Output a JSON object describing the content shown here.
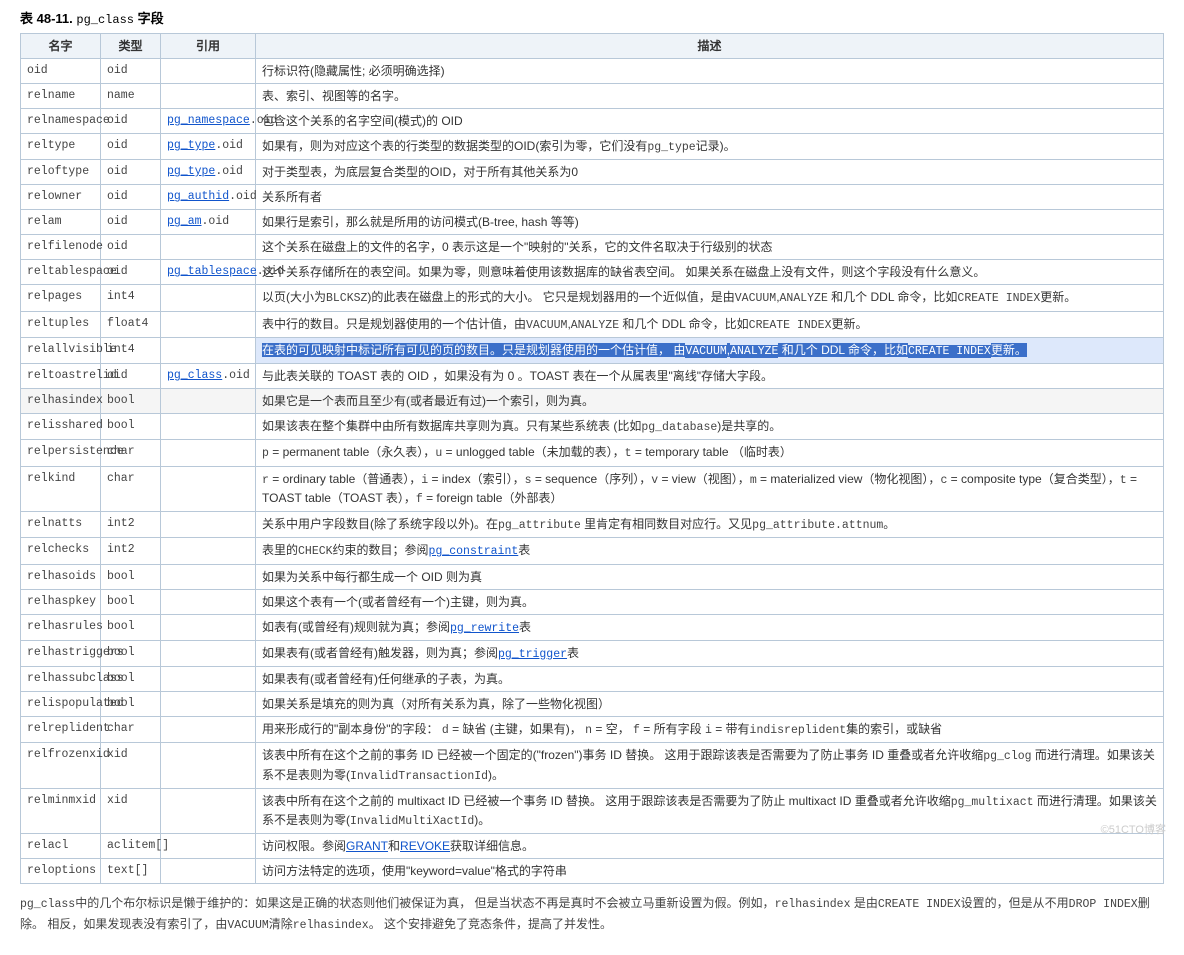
{
  "title_prefix": "表 48-11. ",
  "title_mono": "pg_class",
  "title_suffix": " 字段",
  "columns": {
    "name": "名字",
    "type": "类型",
    "ref": "引用",
    "desc": "描述"
  },
  "rows": [
    {
      "name": "oid",
      "type": "oid",
      "ref_link": "",
      "ref_suffix": "",
      "desc_parts": [
        {
          "t": "行标识符(隐藏属性; 必须明确选择)"
        }
      ]
    },
    {
      "name": "relname",
      "type": "name",
      "ref_link": "",
      "ref_suffix": "",
      "desc_parts": [
        {
          "t": "表、索引、视图等的名字。"
        }
      ]
    },
    {
      "name": "relnamespace",
      "type": "oid",
      "ref_link": "pg_namespace",
      "ref_suffix": ".oid",
      "desc_parts": [
        {
          "t": "包含这个关系的名字空间(模式)的 OID"
        }
      ]
    },
    {
      "name": "reltype",
      "type": "oid",
      "ref_link": "pg_type",
      "ref_suffix": ".oid",
      "desc_parts": [
        {
          "t": "如果有，则为对应这个表的行类型的数据类型的OID(索引为零，它们没有"
        },
        {
          "m": "pg_type"
        },
        {
          "t": "记录)。"
        }
      ]
    },
    {
      "name": "reloftype",
      "type": "oid",
      "ref_link": "pg_type",
      "ref_suffix": ".oid",
      "desc_parts": [
        {
          "t": "对于类型表，为底层复合类型的OID，对于所有其他关系为0"
        }
      ]
    },
    {
      "name": "relowner",
      "type": "oid",
      "ref_link": "pg_authid",
      "ref_suffix": ".oid",
      "desc_parts": [
        {
          "t": "关系所有者"
        }
      ]
    },
    {
      "name": "relam",
      "type": "oid",
      "ref_link": "pg_am",
      "ref_suffix": ".oid",
      "desc_parts": [
        {
          "t": "如果行是索引，那么就是所用的访问模式(B-tree, hash 等等)"
        }
      ]
    },
    {
      "name": "relfilenode",
      "type": "oid",
      "ref_link": "",
      "ref_suffix": "",
      "desc_parts": [
        {
          "t": "这个关系在磁盘上的文件的名字，0 表示这是一个\"映射的\"关系，它的文件名取决于行级别的状态"
        }
      ]
    },
    {
      "name": "reltablespace",
      "type": "oid",
      "ref_link": "pg_tablespace",
      "ref_suffix": ".oid",
      "desc_parts": [
        {
          "t": "这个关系存储所在的表空间。如果为零，则意味着使用该数据库的缺省表空间。 如果关系在磁盘上没有文件，则这个字段没有什么意义。"
        }
      ]
    },
    {
      "name": "relpages",
      "type": "int4",
      "ref_link": "",
      "ref_suffix": "",
      "desc_parts": [
        {
          "t": "以页(大小为"
        },
        {
          "m": "BLCKSZ"
        },
        {
          "t": ")的此表在磁盘上的形式的大小。 它只是规划器用的一个近似值，是由"
        },
        {
          "m": "VACUUM"
        },
        {
          "t": ","
        },
        {
          "m": "ANALYZE"
        },
        {
          "t": " 和几个 DDL 命令，比如"
        },
        {
          "m": "CREATE INDEX"
        },
        {
          "t": "更新。"
        }
      ]
    },
    {
      "name": "reltuples",
      "type": "float4",
      "ref_link": "",
      "ref_suffix": "",
      "desc_parts": [
        {
          "t": "表中行的数目。只是规划器使用的一个估计值，由"
        },
        {
          "m": "VACUUM"
        },
        {
          "t": ","
        },
        {
          "m": "ANALYZE"
        },
        {
          "t": " 和几个 DDL 命令，比如"
        },
        {
          "m": "CREATE INDEX"
        },
        {
          "t": "更新。"
        }
      ]
    },
    {
      "name": "relallvisible",
      "type": "int4",
      "ref_link": "",
      "ref_suffix": "",
      "highlight": true,
      "desc_parts": [
        {
          "sel": "在表的可见映射中标记所有可见的页的数目。只是规划器使用的一个估计值， 由"
        },
        {
          "selm": "VACUUM"
        },
        {
          "sel": ","
        },
        {
          "selm": "ANALYZE"
        },
        {
          "sel": " 和几个 DDL 命令，比如"
        },
        {
          "selm": "CREATE INDEX"
        },
        {
          "sel": "更新。"
        }
      ]
    },
    {
      "name": "reltoastrelid",
      "type": "oid",
      "ref_link": "pg_class",
      "ref_suffix": ".oid",
      "desc_parts": [
        {
          "t": "与此表关联的 TOAST 表的 OID ，如果没有为 0 。TOAST 表在一个从属表里\"离线\"存储大字段。"
        }
      ]
    },
    {
      "name": "relhasindex",
      "type": "bool",
      "ref_link": "",
      "ref_suffix": "",
      "shade": true,
      "desc_parts": [
        {
          "t": "如果它是一个表而且至少有(或者最近有过)一个索引，则为真。"
        }
      ]
    },
    {
      "name": "relisshared",
      "type": "bool",
      "ref_link": "",
      "ref_suffix": "",
      "desc_parts": [
        {
          "t": "如果该表在整个集群中由所有数据库共享则为真。只有某些系统表 (比如"
        },
        {
          "m": "pg_database"
        },
        {
          "t": ")是共享的。"
        }
      ]
    },
    {
      "name": "relpersistence",
      "type": "char",
      "ref_link": "",
      "ref_suffix": "",
      "desc_parts": [
        {
          "m": "p"
        },
        {
          "t": " = permanent table（永久表），"
        },
        {
          "m": "u"
        },
        {
          "t": " = unlogged table（未加载的表），"
        },
        {
          "m": "t"
        },
        {
          "t": " = temporary table （临时表）"
        }
      ]
    },
    {
      "name": "relkind",
      "type": "char",
      "ref_link": "",
      "ref_suffix": "",
      "desc_parts": [
        {
          "m": "r"
        },
        {
          "t": " = ordinary table（普通表），"
        },
        {
          "m": "i"
        },
        {
          "t": " = index（索引），"
        },
        {
          "m": "s"
        },
        {
          "t": " = sequence（序列），"
        },
        {
          "m": "v"
        },
        {
          "t": " = view（视图），"
        },
        {
          "m": "m"
        },
        {
          "t": " = materialized view（物化视图），"
        },
        {
          "m": "c"
        },
        {
          "t": " = composite type（复合类型），"
        },
        {
          "m": "t"
        },
        {
          "t": " = TOAST table（TOAST 表），"
        },
        {
          "m": "f"
        },
        {
          "t": " = foreign table（外部表）"
        }
      ]
    },
    {
      "name": "relnatts",
      "type": "int2",
      "ref_link": "",
      "ref_suffix": "",
      "desc_parts": [
        {
          "t": "关系中用户字段数目(除了系统字段以外)。在"
        },
        {
          "m": "pg_attribute"
        },
        {
          "t": " 里肯定有相同数目对应行。又见"
        },
        {
          "m": "pg_attribute.attnum"
        },
        {
          "t": "。"
        }
      ]
    },
    {
      "name": "relchecks",
      "type": "int2",
      "ref_link": "",
      "ref_suffix": "",
      "desc_parts": [
        {
          "t": "表里的"
        },
        {
          "m": "CHECK"
        },
        {
          "t": "约束的数目；参阅"
        },
        {
          "l": "pg_constraint"
        },
        {
          "t": "表"
        }
      ]
    },
    {
      "name": "relhasoids",
      "type": "bool",
      "ref_link": "",
      "ref_suffix": "",
      "desc_parts": [
        {
          "t": "如果为关系中每行都生成一个 OID 则为真"
        }
      ]
    },
    {
      "name": "relhaspkey",
      "type": "bool",
      "ref_link": "",
      "ref_suffix": "",
      "desc_parts": [
        {
          "t": "如果这个表有一个(或者曾经有一个)主键，则为真。"
        }
      ]
    },
    {
      "name": "relhasrules",
      "type": "bool",
      "ref_link": "",
      "ref_suffix": "",
      "desc_parts": [
        {
          "t": "如表有(或曾经有)规则就为真；参阅"
        },
        {
          "l": "pg_rewrite"
        },
        {
          "t": "表"
        }
      ]
    },
    {
      "name": "relhastriggers",
      "type": "bool",
      "ref_link": "",
      "ref_suffix": "",
      "desc_parts": [
        {
          "t": "如果表有(或者曾经有)触发器，则为真；参阅"
        },
        {
          "l": "pg_trigger"
        },
        {
          "t": "表"
        }
      ]
    },
    {
      "name": "relhassubclass",
      "type": "bool",
      "ref_link": "",
      "ref_suffix": "",
      "desc_parts": [
        {
          "t": "如果表有(或者曾经有)任何继承的子表，为真。"
        }
      ]
    },
    {
      "name": "relispopulated",
      "type": "bool",
      "ref_link": "",
      "ref_suffix": "",
      "desc_parts": [
        {
          "t": "如果关系是填充的则为真（对所有关系为真，除了一些物化视图）"
        }
      ]
    },
    {
      "name": "relreplident",
      "type": "char",
      "ref_link": "",
      "ref_suffix": "",
      "desc_parts": [
        {
          "t": "用来形成行的\"副本身份\"的字段： "
        },
        {
          "m": "d"
        },
        {
          "t": " = 缺省 (主键，如果有)， "
        },
        {
          "m": "n"
        },
        {
          "t": " = 空， "
        },
        {
          "m": "f"
        },
        {
          "t": " = 所有字段 "
        },
        {
          "m": "i"
        },
        {
          "t": " = 带有"
        },
        {
          "m": "indisreplident"
        },
        {
          "t": "集的索引，或缺省"
        }
      ]
    },
    {
      "name": "relfrozenxid",
      "type": "xid",
      "ref_link": "",
      "ref_suffix": "",
      "desc_parts": [
        {
          "t": "该表中所有在这个之前的事务 ID 已经被一个固定的(\"frozen\")事务 ID 替换。 这用于跟踪该表是否需要为了防止事务 ID 重叠或者允许收缩"
        },
        {
          "m": "pg_clog"
        },
        {
          "t": " 而进行清理。如果该关系不是表则为零("
        },
        {
          "m": "InvalidTransactionId"
        },
        {
          "t": ")。"
        }
      ]
    },
    {
      "name": "relminmxid",
      "type": "xid",
      "ref_link": "",
      "ref_suffix": "",
      "desc_parts": [
        {
          "t": "该表中所有在这个之前的 multixact ID 已经被一个事务 ID 替换。 这用于跟踪该表是否需要为了防止 multixact ID 重叠或者允许收缩"
        },
        {
          "m": "pg_multixact"
        },
        {
          "t": " 而进行清理。如果该关系不是表则为零("
        },
        {
          "m": "InvalidMultiXactId"
        },
        {
          "t": ")。"
        }
      ]
    },
    {
      "name": "relacl",
      "type": "aclitem[]",
      "ref_link": "",
      "ref_suffix": "",
      "desc_parts": [
        {
          "t": "访问权限。参阅"
        },
        {
          "L": "GRANT"
        },
        {
          "t": "和"
        },
        {
          "L": "REVOKE"
        },
        {
          "t": "获取详细信息。"
        }
      ]
    },
    {
      "name": "reloptions",
      "type": "text[]",
      "ref_link": "",
      "ref_suffix": "",
      "desc_parts": [
        {
          "t": "访问方法特定的选项，使用\"keyword=value\"格式的字符串"
        }
      ]
    }
  ],
  "footnote_parts": [
    {
      "m": "pg_class"
    },
    {
      "t": "中的几个布尔标识是懒于维护的：如果这是正确的状态则他们被保证为真， 但是当状态不再是真时不会被立马重新设置为假。例如，"
    },
    {
      "m": "relhasindex"
    },
    {
      "t": " 是由"
    },
    {
      "m": "CREATE INDEX"
    },
    {
      "t": "设置的，但是从不用"
    },
    {
      "m": "DROP INDEX"
    },
    {
      "t": "删除。 相反，如果发现表没有索引了，由"
    },
    {
      "m": "VACUUM"
    },
    {
      "t": "清除"
    },
    {
      "m": "relhasindex"
    },
    {
      "t": "。 这个安排避免了竞态条件，提高了并发性。"
    }
  ],
  "watermark": "©51CTO博客"
}
